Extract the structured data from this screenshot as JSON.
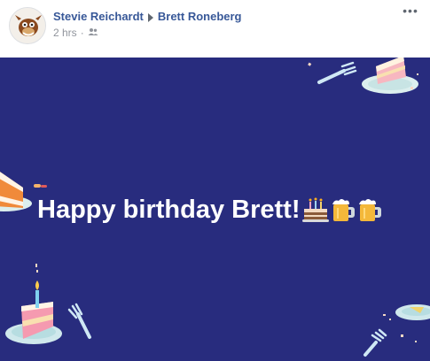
{
  "post": {
    "author": "Stevie Reichardt",
    "recipient": "Brett Roneberg",
    "time": "2 hrs",
    "separator": "·",
    "privacy_icon": "friends-icon",
    "more_label": "•••"
  },
  "card": {
    "message": "Happy birthday Brett!",
    "background_color": "#282c7e",
    "emojis": [
      "birthday-cake-icon",
      "beer-mug-icon",
      "beer-mug-icon"
    ]
  }
}
